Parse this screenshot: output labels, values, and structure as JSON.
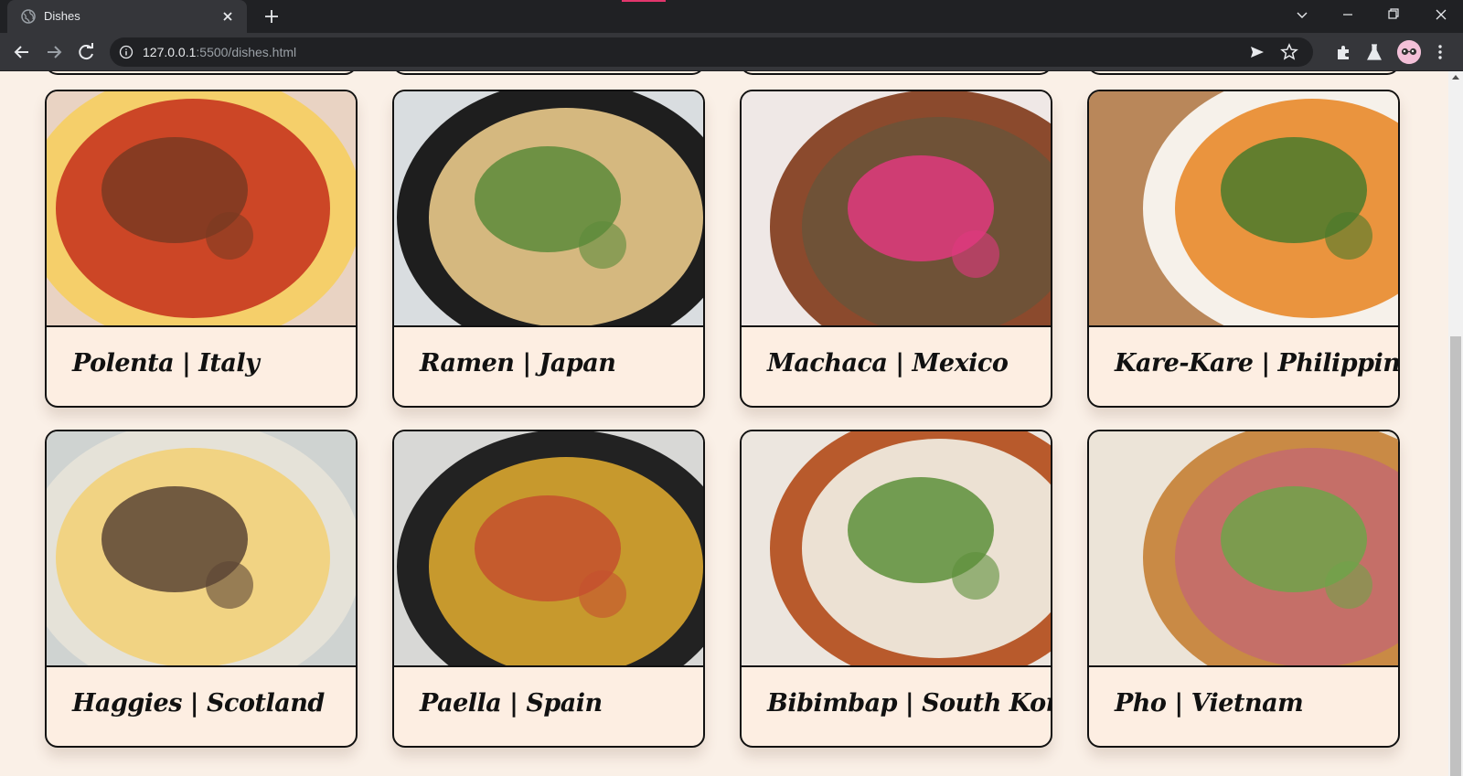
{
  "browser": {
    "tab_title": "Dishes",
    "url_host": "127.0.0.1",
    "url_path": ":5500/dishes.html"
  },
  "dishes": [
    {
      "title": "Polenta | Italy",
      "palette": [
        "#e9d3c3",
        "#f5cf6a",
        "#c8361f",
        "#7a3a22"
      ]
    },
    {
      "title": "Ramen | Japan",
      "palette": [
        "#d9dde0",
        "#1e1e1e",
        "#e9c98a",
        "#5c8a3a"
      ]
    },
    {
      "title": "Machaca | Mexico",
      "palette": [
        "#efe8e6",
        "#8b4a2d",
        "#6b5338",
        "#e0397e"
      ]
    },
    {
      "title": "Kare-Kare | Philippines",
      "palette": [
        "#b9875a",
        "#f6f1ea",
        "#e98a2b",
        "#4a7a2c"
      ]
    },
    {
      "title": "Haggies | Scotland",
      "palette": [
        "#cfd3d1",
        "#e5e2d8",
        "#f2d27a",
        "#5b4435"
      ]
    },
    {
      "title": "Paella | Spain",
      "palette": [
        "#d8d8d6",
        "#222222",
        "#d9a62f",
        "#c4502e"
      ]
    },
    {
      "title": "Bibimbap | South Korea",
      "palette": [
        "#ece6df",
        "#b85a2c",
        "#f2f0e6",
        "#5d8f3a"
      ]
    },
    {
      "title": "Pho | Vietnam",
      "palette": [
        "#ece4d8",
        "#c98a45",
        "#c46b6b",
        "#6fa34a"
      ]
    }
  ]
}
